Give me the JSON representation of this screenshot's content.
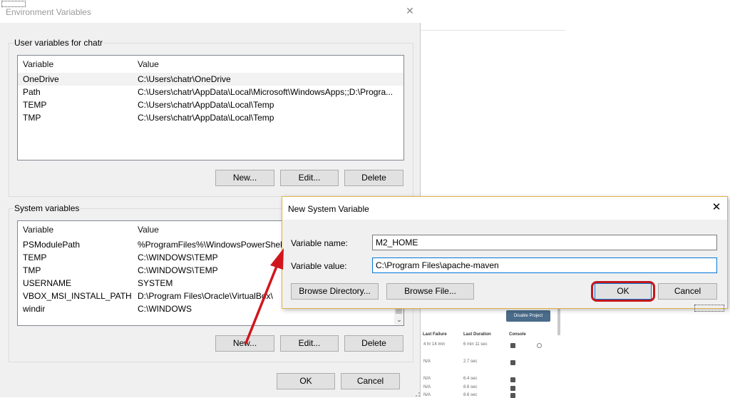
{
  "window": {
    "title": "Environment Variables"
  },
  "user_vars": {
    "group_label": "User variables for chatr",
    "columns": [
      "Variable",
      "Value"
    ],
    "rows": [
      {
        "variable": "OneDrive",
        "value": "C:\\Users\\chatr\\OneDrive"
      },
      {
        "variable": "Path",
        "value": "C:\\Users\\chatr\\AppData\\Local\\Microsoft\\WindowsApps;;D:\\Progra..."
      },
      {
        "variable": "TEMP",
        "value": "C:\\Users\\chatr\\AppData\\Local\\Temp"
      },
      {
        "variable": "TMP",
        "value": "C:\\Users\\chatr\\AppData\\Local\\Temp"
      }
    ],
    "buttons": {
      "new": "New...",
      "edit": "Edit...",
      "delete": "Delete"
    }
  },
  "system_vars": {
    "group_label": "System variables",
    "columns": [
      "Variable",
      "Value"
    ],
    "rows": [
      {
        "variable": "PSModulePath",
        "value": "%ProgramFiles%\\WindowsPowerShell\\M"
      },
      {
        "variable": "TEMP",
        "value": "C:\\WINDOWS\\TEMP"
      },
      {
        "variable": "TMP",
        "value": "C:\\WINDOWS\\TEMP"
      },
      {
        "variable": "USERNAME",
        "value": "SYSTEM"
      },
      {
        "variable": "VBOX_MSI_INSTALL_PATH",
        "value": "D:\\Program Files\\Oracle\\VirtualBox\\"
      },
      {
        "variable": "windir",
        "value": "C:\\WINDOWS"
      }
    ],
    "buttons": {
      "new": "New...",
      "edit": "Edit...",
      "delete": "Delete"
    }
  },
  "footer": {
    "ok": "OK",
    "cancel": "Cancel"
  },
  "dialog": {
    "title": "New System Variable",
    "name_label": "Variable name:",
    "name_value": "M2_HOME",
    "value_label": "Variable value:",
    "value_value": "C:\\Program Files\\apache-maven",
    "browse_directory": "Browse Directory...",
    "browse_file": "Browse File...",
    "ok": "OK",
    "cancel": "Cancel"
  },
  "background": {
    "disable_button": "Disable Project",
    "headers": [
      "Last Failure",
      "Last Duration",
      "Console"
    ],
    "rows": [
      {
        "failure": "4 hr 14 min",
        "duration": "6 min 11 sec"
      },
      {
        "failure": "N/A",
        "duration": "2.7 sec"
      },
      {
        "failure": "N/A",
        "duration": "6.4 sec"
      },
      {
        "failure": "N/A",
        "duration": "8.6 sec"
      },
      {
        "failure": "N/A",
        "duration": "8.6 sec"
      }
    ]
  },
  "colors": {
    "highlight": "#c4161c",
    "accent": "#0078d7",
    "dialog_border": "#e0b24a"
  },
  "icons": {
    "close": "close-icon",
    "annotation_arrow": "arrow-icon",
    "scroll_down": "chevron-down-icon"
  }
}
